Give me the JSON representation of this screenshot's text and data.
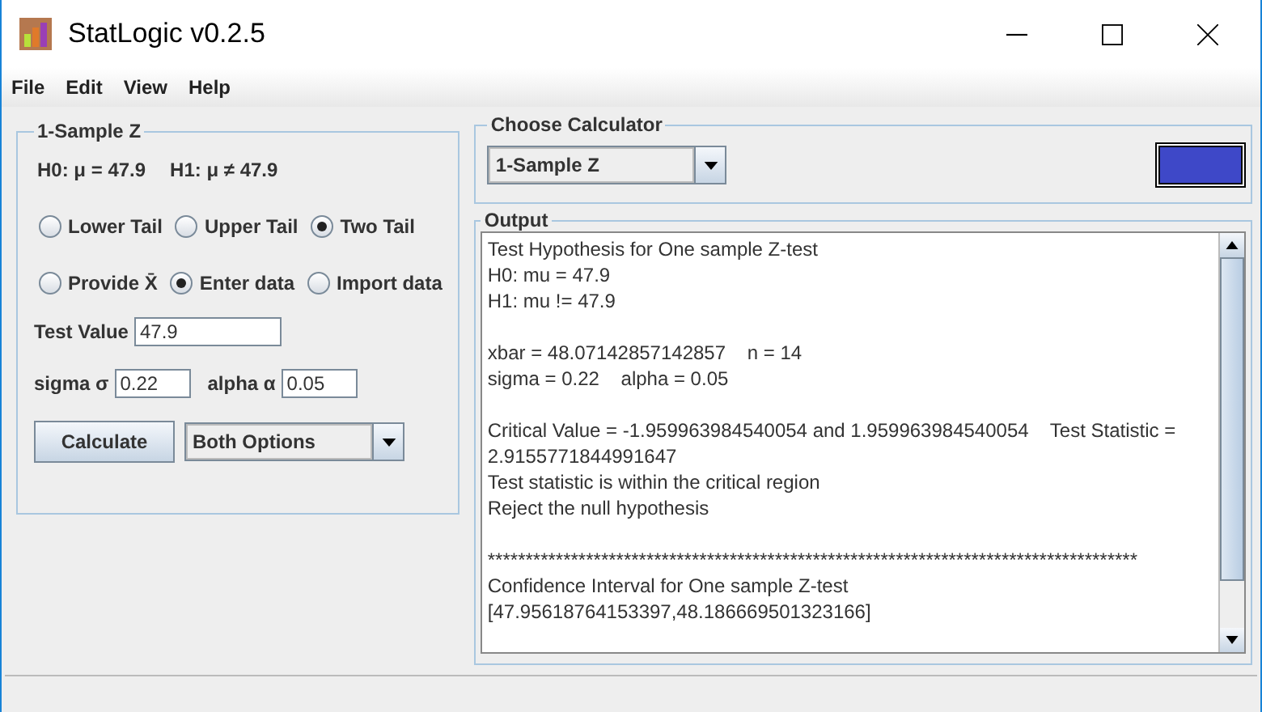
{
  "window": {
    "title": "StatLogic v0.2.5"
  },
  "menu": [
    "File",
    "Edit",
    "View",
    "Help"
  ],
  "test_panel": {
    "title": "1-Sample Z",
    "h0": "H0: μ = 47.9",
    "h1": "H1: μ ≠ 47.9",
    "tails": [
      {
        "label": "Lower Tail",
        "selected": false
      },
      {
        "label": "Upper Tail",
        "selected": false
      },
      {
        "label": "Two Tail",
        "selected": true
      }
    ],
    "inputs": [
      {
        "label": "Provide X̄",
        "selected": false
      },
      {
        "label": "Enter data",
        "selected": true
      },
      {
        "label": "Import data",
        "selected": false
      }
    ],
    "test_value": {
      "label": "Test Value",
      "value": "47.9"
    },
    "sigma": {
      "label": "sigma σ",
      "value": "0.22"
    },
    "alpha": {
      "label": "alpha α",
      "value": "0.05"
    },
    "calculate_button": "Calculate",
    "options": "Both Options"
  },
  "calculator_panel": {
    "title": "Choose Calculator",
    "value": "1-Sample Z",
    "color": "#3e48c8"
  },
  "output_panel": {
    "title": "Output",
    "paragraphs": [
      [
        "Test Hypothesis for One sample Z-test",
        "H0: mu = 47.9",
        "H1: mu != 47.9"
      ],
      [
        "xbar = 48.07142857142857    n = 14",
        "sigma = 0.22    alpha = 0.05"
      ],
      [
        "Critical Value = -1.959963984540054 and 1.959963984540054    Test Statistic =",
        "2.9155771844991647",
        "Test statistic is within the critical region",
        "Reject the null hypothesis"
      ],
      [
        "**************************************************************************************",
        "Confidence Interval for One sample Z-test",
        "[47.95618764153397,48.186669501323166]"
      ]
    ]
  }
}
